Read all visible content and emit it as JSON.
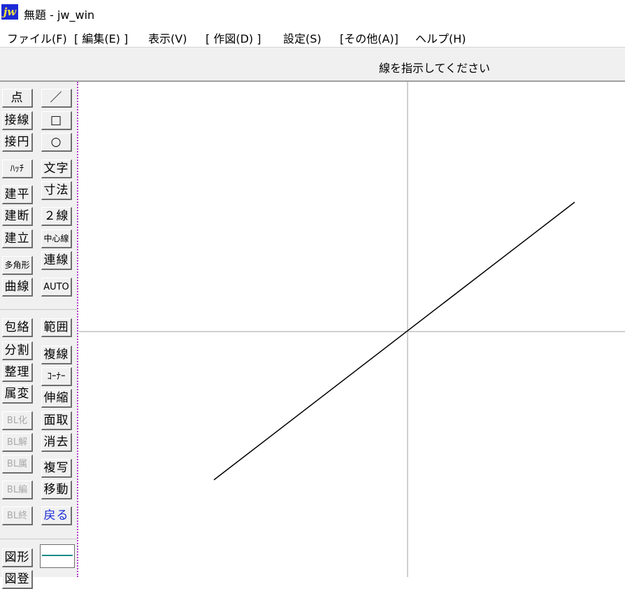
{
  "window": {
    "logo_text": "jw",
    "title": "無題 - jw_win"
  },
  "menu": [
    {
      "label": "ファイル(F)"
    },
    {
      "label": "[ 編集(E) ]"
    },
    {
      "label": "表示(V)"
    },
    {
      "label": "[ 作図(D) ]"
    },
    {
      "label": "設定(S)"
    },
    {
      "label": "[その他(A)]"
    },
    {
      "label": "ヘルプ(H)"
    }
  ],
  "status": {
    "message": "線を指示してください"
  },
  "toolbar": {
    "left_column": [
      "点",
      "接線",
      "接円",
      "ﾊｯﾁ",
      "建平",
      "建断",
      "建立",
      "多角形",
      "曲線",
      "包絡",
      "分割",
      "整理",
      "属変",
      "BL化",
      "BL解",
      "BL属",
      "BL編",
      "BL終",
      "図形",
      "図登"
    ],
    "right_column": [
      "／",
      "□",
      "○",
      "文字",
      "寸法",
      "２線",
      "中心線",
      "連線",
      "AUTO",
      "範囲",
      "複線",
      "ｺｰﾅｰ",
      "伸縮",
      "面取",
      "消去",
      "複写",
      "移動",
      "戻る"
    ],
    "disabled": [
      "BL化",
      "BL解",
      "BL属",
      "BL編",
      "BL終"
    ],
    "highlighted": [
      "戻る"
    ],
    "line_swatch_color": "#1d8a8a"
  },
  "drawing": {
    "axis_color": "#a0a0a0",
    "line_color": "#000000",
    "line_style": "solid diagonal through origin"
  }
}
